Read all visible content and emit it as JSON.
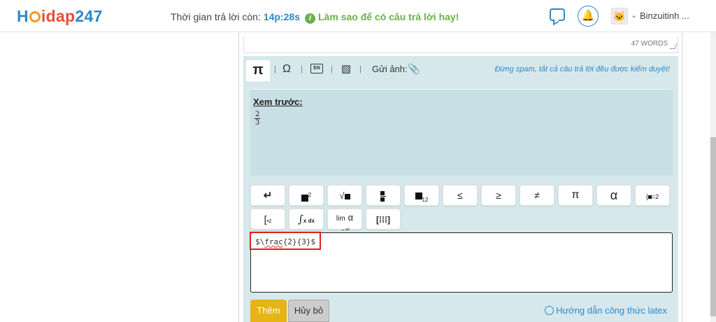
{
  "header": {
    "logo": {
      "h": "H",
      "rest": "idap",
      "num": "247"
    },
    "timer_label": "Thời gian trả lời còn:",
    "timer_value": "14p:28s",
    "help_text": "Làm sao để có câu trả lời hay!",
    "username": "Binzuitinh ..."
  },
  "editor": {
    "words": "47 WORDS",
    "toolbar": {
      "pi": "π",
      "omega": "Ω",
      "upload_label": "Gửi ảnh:",
      "notice": "Đừng spam, tất cả câu trả lời đều được kiểm duyệt!"
    },
    "preview": {
      "title": "Xem trước:",
      "numerator": "2",
      "denominator": "3"
    },
    "formula_buttons": {
      "leq": "≤",
      "geq": "≥",
      "neq": "≠",
      "pi": "π",
      "alpha": "α",
      "lim": "lim",
      "lim_sub": "→∞",
      "int_dx": "x dx"
    },
    "latex_code": {
      "prefix": "$\\",
      "command": "frac",
      "suffix": "{2}{3}$"
    },
    "add_label": "Thêm",
    "cancel_label": "Hủy bỏ",
    "guide_label": "Hướng dẫn công thức latex"
  }
}
